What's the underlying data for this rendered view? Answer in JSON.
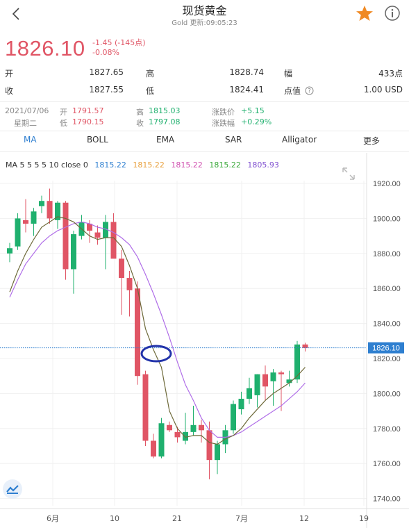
{
  "header": {
    "title": "现货黄金",
    "subtitle": "Gold 更新:09:05:23"
  },
  "quote": {
    "price": "1826.10",
    "change": "-1.45 (-145点)",
    "change_pct": "-0.08%"
  },
  "stats": [
    {
      "label": "开",
      "value": "1827.65"
    },
    {
      "label": "高",
      "value": "1828.74"
    },
    {
      "label": "幅",
      "value": "433点"
    },
    {
      "label": "收",
      "value": "1827.55"
    },
    {
      "label": "低",
      "value": "1824.41"
    },
    {
      "label": "点值",
      "value": "1.00 USD"
    }
  ],
  "day": {
    "date": "2021/07/06",
    "weekday": "星期二",
    "open_label": "开",
    "open": "1791.57",
    "low_label": "低",
    "low": "1790.15",
    "high_label": "高",
    "high": "1815.03",
    "close_label": "收",
    "close": "1797.08",
    "chg_label": "涨跌价",
    "chg": "+5.15",
    "chg_pct_label": "涨跌幅",
    "chg_pct": "+0.29%"
  },
  "tabs": [
    {
      "label": "MA",
      "active": true
    },
    {
      "label": "BOLL",
      "active": false
    },
    {
      "label": "EMA",
      "active": false
    },
    {
      "label": "SAR",
      "active": false
    },
    {
      "label": "Alligator",
      "active": false
    },
    {
      "label": "更多",
      "active": false
    }
  ],
  "ma_legend": {
    "params": "MA  5 5 5 5 10 close 0",
    "values": [
      {
        "value": "1815.22",
        "color": "#2e7fd0"
      },
      {
        "value": "1815.22",
        "color": "#e8a03c"
      },
      {
        "value": "1815.22",
        "color": "#d050b0"
      },
      {
        "value": "1815.22",
        "color": "#38a838"
      },
      {
        "value": "1805.93",
        "color": "#8050d0"
      }
    ]
  },
  "colors": {
    "up": "#1fb06e",
    "down": "#e05565",
    "ma5": "#6e6a3a",
    "ma10": "#b06ee8",
    "accent": "#2e7fd0",
    "star": "#f08a24",
    "marker": "#2233aa"
  },
  "icons": {
    "back": "chevron-left-icon",
    "favorite": "star-icon",
    "info": "info-icon",
    "fullscreen": "expand-arrows-icon",
    "logo": "tradingview-logo-icon"
  },
  "chart_data": {
    "type": "candlestick",
    "ylim": [
      1735,
      1930
    ],
    "y_ticks": [
      "1920.00",
      "1900.00",
      "1880.00",
      "1860.00",
      "1840.00",
      "1820.00",
      "1800.00",
      "1780.00",
      "1760.00",
      "1740.00"
    ],
    "x_ticks": [
      "6月",
      "10",
      "21",
      "7月",
      "12",
      "19"
    ],
    "current_price_label": "1826.10",
    "current_price": 1826.1,
    "candles": [
      {
        "o": 1880,
        "h": 1886,
        "l": 1875,
        "c": 1883
      },
      {
        "o": 1884,
        "h": 1903,
        "l": 1882,
        "c": 1900
      },
      {
        "o": 1899,
        "h": 1911,
        "l": 1892,
        "c": 1897
      },
      {
        "o": 1897,
        "h": 1906,
        "l": 1890,
        "c": 1904
      },
      {
        "o": 1907,
        "h": 1913,
        "l": 1903,
        "c": 1910
      },
      {
        "o": 1910,
        "h": 1917,
        "l": 1897,
        "c": 1900
      },
      {
        "o": 1899,
        "h": 1910,
        "l": 1894,
        "c": 1909
      },
      {
        "o": 1909,
        "h": 1910,
        "l": 1865,
        "c": 1871
      },
      {
        "o": 1871,
        "h": 1893,
        "l": 1857,
        "c": 1891
      },
      {
        "o": 1890,
        "h": 1902,
        "l": 1888,
        "c": 1898
      },
      {
        "o": 1897,
        "h": 1899,
        "l": 1886,
        "c": 1893
      },
      {
        "o": 1892,
        "h": 1896,
        "l": 1885,
        "c": 1889
      },
      {
        "o": 1889,
        "h": 1902,
        "l": 1871,
        "c": 1898
      },
      {
        "o": 1898,
        "h": 1903,
        "l": 1884,
        "c": 1877
      },
      {
        "o": 1877,
        "h": 1882,
        "l": 1845,
        "c": 1866
      },
      {
        "o": 1866,
        "h": 1870,
        "l": 1844,
        "c": 1859
      },
      {
        "o": 1860,
        "h": 1864,
        "l": 1805,
        "c": 1810
      },
      {
        "o": 1811,
        "h": 1813,
        "l": 1770,
        "c": 1773
      },
      {
        "o": 1773,
        "h": 1777,
        "l": 1763,
        "c": 1764
      },
      {
        "o": 1764,
        "h": 1786,
        "l": 1763,
        "c": 1783
      },
      {
        "o": 1782,
        "h": 1784,
        "l": 1778,
        "c": 1779
      },
      {
        "o": 1778,
        "h": 1781,
        "l": 1772,
        "c": 1775
      },
      {
        "o": 1773,
        "h": 1789,
        "l": 1771,
        "c": 1778
      },
      {
        "o": 1778,
        "h": 1793,
        "l": 1776,
        "c": 1782
      },
      {
        "o": 1782,
        "h": 1785,
        "l": 1772,
        "c": 1779
      },
      {
        "o": 1779,
        "h": 1784,
        "l": 1751,
        "c": 1762
      },
      {
        "o": 1762,
        "h": 1773,
        "l": 1754,
        "c": 1771
      },
      {
        "o": 1771,
        "h": 1782,
        "l": 1766,
        "c": 1779
      },
      {
        "o": 1779,
        "h": 1796,
        "l": 1777,
        "c": 1794
      },
      {
        "o": 1791,
        "h": 1801,
        "l": 1788,
        "c": 1797
      },
      {
        "o": 1797,
        "h": 1809,
        "l": 1794,
        "c": 1803
      },
      {
        "o": 1799,
        "h": 1811,
        "l": 1792,
        "c": 1811
      },
      {
        "o": 1811,
        "h": 1816,
        "l": 1796,
        "c": 1804
      },
      {
        "o": 1807,
        "h": 1814,
        "l": 1793,
        "c": 1812
      },
      {
        "o": 1812,
        "h": 1813,
        "l": 1790,
        "c": 1811
      },
      {
        "o": 1806,
        "h": 1813,
        "l": 1804,
        "c": 1808
      },
      {
        "o": 1808,
        "h": 1830,
        "l": 1806,
        "c": 1828
      },
      {
        "o": 1828,
        "h": 1829,
        "l": 1824,
        "c": 1826
      }
    ],
    "ma5": [
      1858,
      1870,
      1880,
      1888,
      1895,
      1898,
      1901,
      1900,
      1898,
      1894,
      1890,
      1888,
      1889,
      1889,
      1884,
      1873,
      1860,
      1837,
      1825,
      1815,
      1790,
      1780,
      1775,
      1776,
      1776,
      1772,
      1771,
      1774,
      1776,
      1780,
      1786,
      1791,
      1796,
      1800,
      1803,
      1806,
      1810,
      1815
    ],
    "ma10": [
      1855,
      1865,
      1874,
      1880,
      1886,
      1890,
      1893,
      1895,
      1897,
      1898,
      1897,
      1895,
      1894,
      1892,
      1889,
      1885,
      1878,
      1868,
      1857,
      1845,
      1832,
      1818,
      1805,
      1796,
      1786,
      1779,
      1775,
      1775,
      1776,
      1778,
      1781,
      1784,
      1787,
      1790,
      1793,
      1797,
      1801,
      1806
    ]
  }
}
